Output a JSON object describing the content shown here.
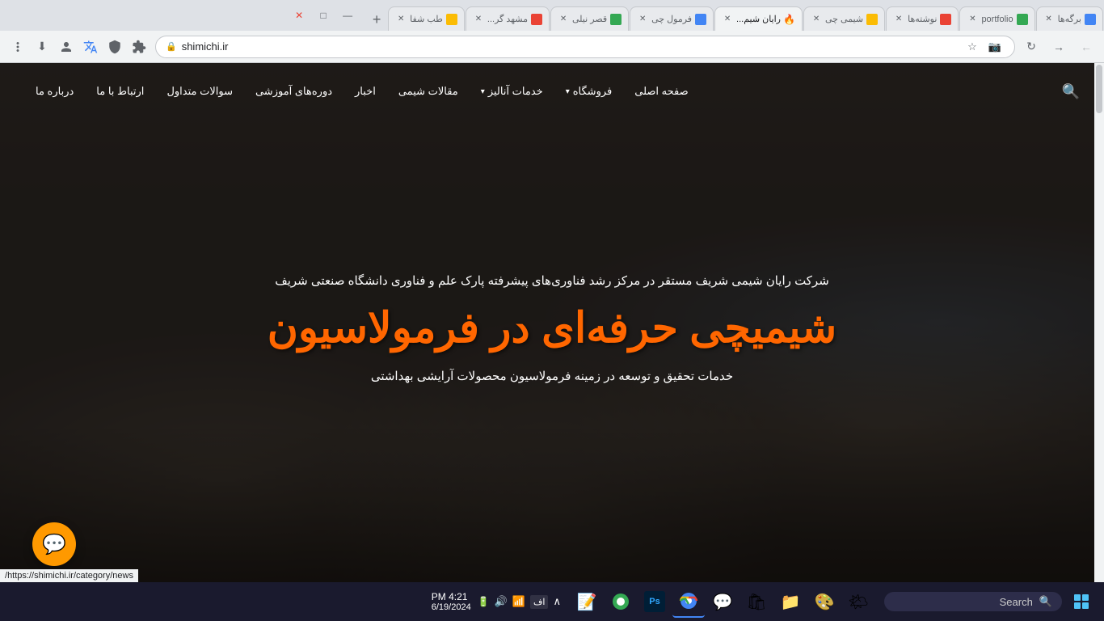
{
  "browser": {
    "tabs": [
      {
        "id": "tab1",
        "label": "برگه‌ها",
        "favicon_color": "#4285f4",
        "active": false
      },
      {
        "id": "tab2",
        "label": "portfolio",
        "favicon_color": "#34a853",
        "active": false
      },
      {
        "id": "tab3",
        "label": "نوشته‌ها",
        "favicon_color": "#ea4335",
        "active": false
      },
      {
        "id": "tab4",
        "label": "شیمی چی",
        "favicon_color": "#fbbc04",
        "active": false
      },
      {
        "id": "tab5",
        "label": "رایان شیم...",
        "favicon_color": "#ff6600",
        "active": true
      },
      {
        "id": "tab6",
        "label": "فرمول چی",
        "favicon_color": "#4285f4",
        "active": false
      },
      {
        "id": "tab7",
        "label": "قصر نیلی",
        "favicon_color": "#34a853",
        "active": false
      },
      {
        "id": "tab8",
        "label": "مشهد گر...",
        "favicon_color": "#ea4335",
        "active": false
      },
      {
        "id": "tab9",
        "label": "طب شفا",
        "favicon_color": "#fbbc04",
        "active": false
      }
    ],
    "url": "shimichi.ir",
    "status_url": "https://shimichi.ir/category/news/"
  },
  "nav": {
    "items": [
      {
        "label": "صفحه اصلی",
        "has_arrow": false
      },
      {
        "label": "فروشگاه",
        "has_arrow": true
      },
      {
        "label": "خدمات آنالیز",
        "has_arrow": true
      },
      {
        "label": "مقالات شیمی",
        "has_arrow": false
      },
      {
        "label": "اخبار",
        "has_arrow": false
      },
      {
        "label": "دوره‌های آموزشی",
        "has_arrow": false
      },
      {
        "label": "سوالات متداول",
        "has_arrow": false
      },
      {
        "label": "ارتباط با ما",
        "has_arrow": false
      },
      {
        "label": "درباره ما",
        "has_arrow": false
      }
    ]
  },
  "hero": {
    "subtitle": "شرکت رایان شیمی شریف مستقر در مرکز رشد فناوری‌های پیشرفته پارک علم و فناوری دانشگاه صنعتی شریف",
    "title": "شیمیچی حرفه‌ای در فرمولاسیون",
    "description": "خدمات تحقیق و توسعه در زمینه فرمولاسیون محصولات آرایشی بهداشتی"
  },
  "chat": {
    "icon": "💬"
  },
  "taskbar": {
    "search_placeholder": "Search",
    "time": "4:21 PM",
    "date": "6/19/2024",
    "language": "اف",
    "apps": [
      {
        "name": "windows-widget",
        "icon": "🌤",
        "color": "#4fc3f7"
      },
      {
        "name": "taskbar-app-colorful",
        "icon": "🎨",
        "color": "#ff7043"
      },
      {
        "name": "taskbar-app-folder",
        "icon": "📁",
        "color": "#ffb300"
      },
      {
        "name": "taskbar-app-store",
        "icon": "🛍",
        "color": "#4285f4"
      },
      {
        "name": "taskbar-app-chat",
        "icon": "💬",
        "color": "#7c4dff"
      },
      {
        "name": "taskbar-app-chrome",
        "icon": "⬤",
        "color": "#4285f4"
      },
      {
        "name": "taskbar-app-ps",
        "icon": "Ps",
        "color": "#001e36"
      },
      {
        "name": "taskbar-app-chrome2",
        "icon": "⬤",
        "color": "#34a853"
      },
      {
        "name": "taskbar-app-notes",
        "icon": "📝",
        "color": "#ffeb3b"
      }
    ]
  },
  "icons": {
    "search": "🔍",
    "back": "←",
    "forward": "→",
    "refresh": "↻",
    "lock": "🔒",
    "star": "☆",
    "camera": "📷",
    "extensions": "🧩",
    "profile": "👤",
    "download": "⬇",
    "menu": "⋮",
    "minimize": "—",
    "maximize": "□",
    "close": "✕",
    "new_tab": "+",
    "tab_close": "✕",
    "scroll_up": "▲",
    "wifi": "📶",
    "volume": "🔊",
    "battery": "🔋",
    "arrow_up": "∧"
  }
}
